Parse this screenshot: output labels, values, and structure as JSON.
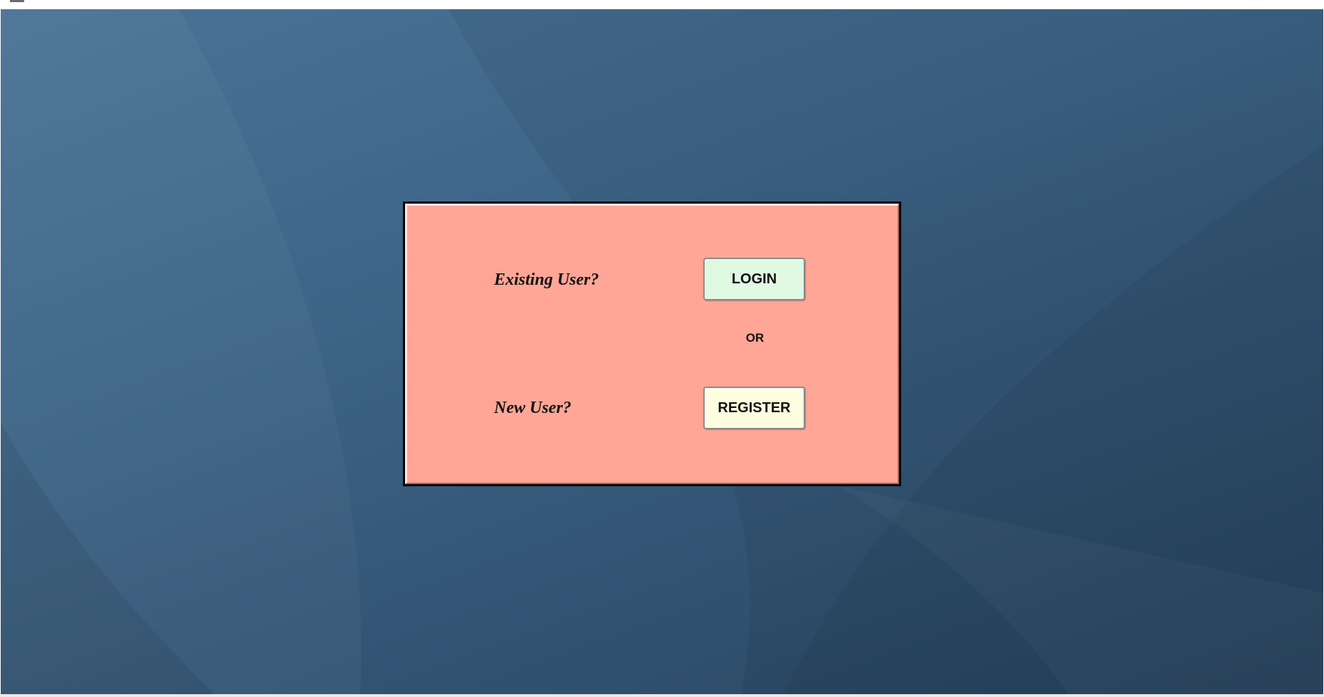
{
  "window": {
    "titlebar_icon": "window-menu-icon"
  },
  "dialog": {
    "existing_prompt": "Existing User?",
    "login_label": "LOGIN",
    "or_label": "OR",
    "new_prompt": "New User?",
    "register_label": "REGISTER"
  },
  "colors": {
    "desktop": "#3e6587",
    "dialog_background": "#ffa696",
    "login_button": "#dff9e2",
    "register_button": "#fffde0"
  }
}
